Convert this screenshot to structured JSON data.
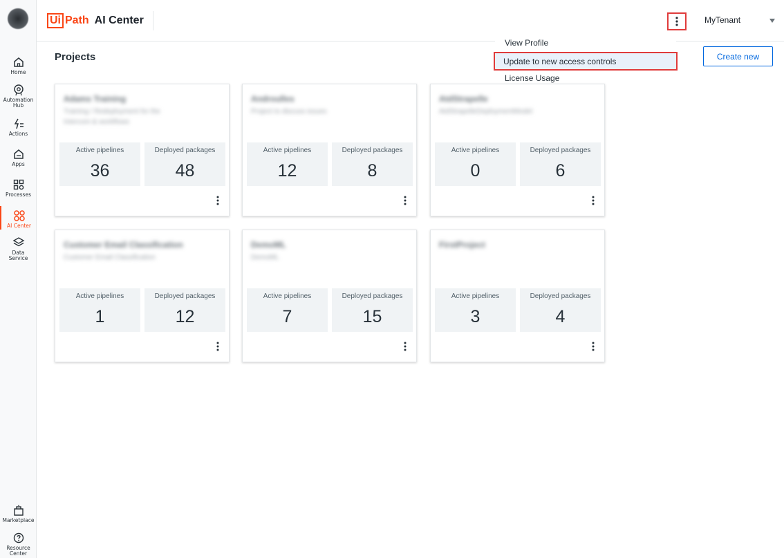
{
  "header": {
    "logo_ui": "Ui",
    "logo_path": "Path",
    "product": "AI Center",
    "tenant": "MyTenant"
  },
  "rail": {
    "items": [
      {
        "label": "Home",
        "icon": "home-icon"
      },
      {
        "label": "Automation\nHub",
        "icon": "automation-hub-icon"
      },
      {
        "label": "Actions",
        "icon": "actions-icon"
      },
      {
        "label": "Apps",
        "icon": "apps-icon"
      },
      {
        "label": "Processes",
        "icon": "processes-icon"
      },
      {
        "label": "AI Center",
        "icon": "ai-center-icon"
      },
      {
        "label": "Data\nService",
        "icon": "data-service-icon"
      },
      {
        "label": "Marketplace",
        "icon": "marketplace-icon"
      },
      {
        "label": "Resource\nCenter",
        "icon": "help-icon"
      }
    ]
  },
  "menu": {
    "items": [
      "View Profile",
      "Update to new access controls",
      "License Usage"
    ]
  },
  "main": {
    "title": "Projects",
    "create_label": "Create new",
    "stat_labels": {
      "pipelines": "Active pipelines",
      "packages": "Deployed packages"
    },
    "projects": [
      {
        "name": "Adams Training",
        "description": "Training / Redeployment for the Intercom & workflows",
        "active_pipelines": "36",
        "deployed_packages": "48"
      },
      {
        "name": "Androulles",
        "description": "Project to discuss issues",
        "active_pipelines": "12",
        "deployed_packages": "8"
      },
      {
        "name": "AtdStrapelle",
        "description": "AtdStrapelleDeploymentModel",
        "active_pipelines": "0",
        "deployed_packages": "6"
      },
      {
        "name": "Customer Email Classification",
        "description": "Customer Email Classification",
        "active_pipelines": "1",
        "deployed_packages": "12"
      },
      {
        "name": "DemoML",
        "description": "DemoML",
        "active_pipelines": "7",
        "deployed_packages": "15"
      },
      {
        "name": "FirstProject",
        "description": "",
        "active_pipelines": "3",
        "deployed_packages": "4"
      }
    ]
  },
  "colors": {
    "brand": "#fa4616",
    "link": "#0067df",
    "highlight": "#e03b3b"
  }
}
